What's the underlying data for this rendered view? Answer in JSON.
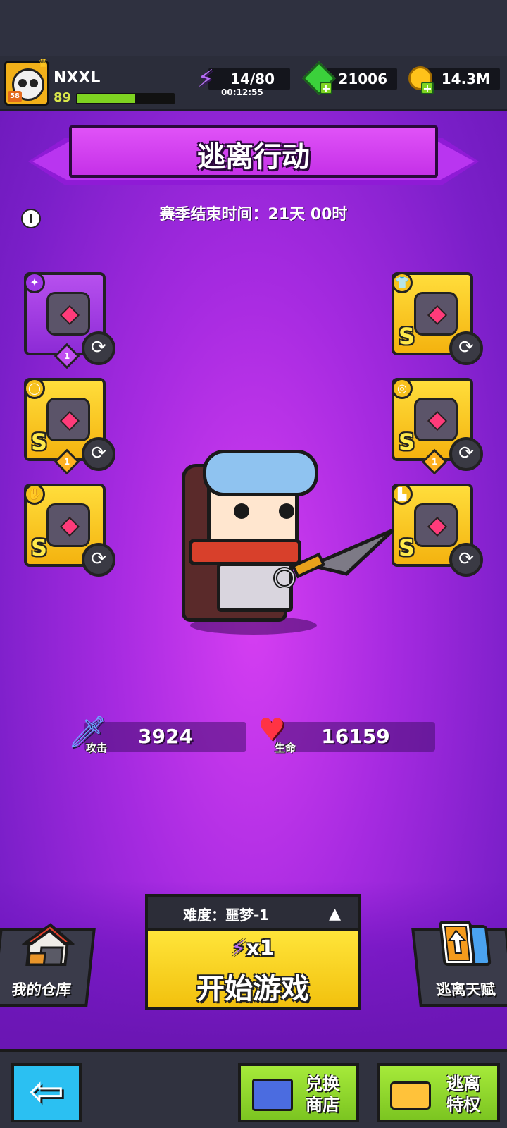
{
  "player": {
    "name": "NXXL",
    "level": "89",
    "avatar_badge": "58",
    "xp_fraction": 0.6
  },
  "resources": {
    "energy": "14/80",
    "energy_timer": "00:12:55",
    "gems": "21006",
    "gold": "14.3M"
  },
  "banner": {
    "title": "逃离行动"
  },
  "season": {
    "text": "赛季结束时间：21天 00时"
  },
  "equipment": {
    "left": [
      {
        "slot": "weapon",
        "rank": "",
        "badge": "1",
        "frame": "purple",
        "category_icon": "dagger-icon"
      },
      {
        "slot": "necklace",
        "rank": "S",
        "badge": "1",
        "frame": "gold",
        "category_icon": "necklace-icon"
      },
      {
        "slot": "gloves",
        "rank": "S",
        "badge": "",
        "frame": "gold",
        "category_icon": "glove-icon"
      }
    ],
    "right": [
      {
        "slot": "armor",
        "rank": "S",
        "badge": "",
        "frame": "gold",
        "category_icon": "armor-icon"
      },
      {
        "slot": "belt",
        "rank": "S",
        "badge": "1",
        "frame": "gold",
        "category_icon": "ring-icon"
      },
      {
        "slot": "boots",
        "rank": "S",
        "badge": "",
        "frame": "gold",
        "category_icon": "boot-icon"
      }
    ]
  },
  "stats": {
    "attack_label": "攻击",
    "attack_value": "3924",
    "hp_label": "生命",
    "hp_value": "16159"
  },
  "play": {
    "difficulty": "难度：噩梦-1",
    "cost": "x1",
    "start_label": "开始游戏"
  },
  "side_buttons": {
    "warehouse": "我的仓库",
    "talent": "逃离天赋"
  },
  "footer": {
    "shop_label": "兑换商店",
    "vip_label": "逃离特权"
  },
  "colors": {
    "background": "#a52ae0",
    "gold_frame": "#f4b30f",
    "purple_frame": "#9e36e6",
    "start_button": "#ffe53a",
    "footer_green": "#7cc521"
  }
}
